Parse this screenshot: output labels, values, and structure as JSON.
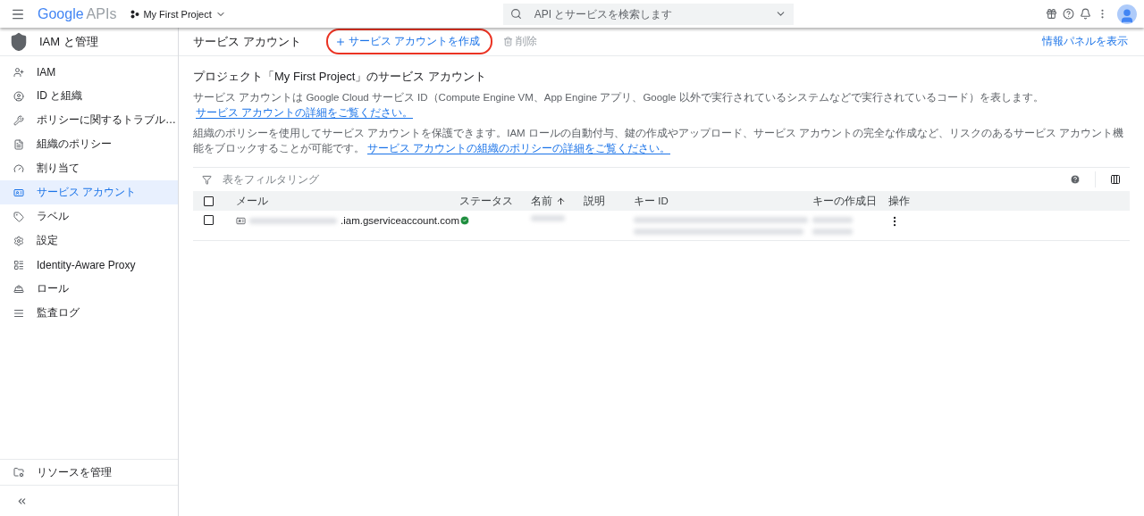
{
  "topbar": {
    "logo_brand": "Google",
    "logo_product": "APIs",
    "project": "My First Project",
    "search": {
      "placeholder": "API とサービスを検索します"
    }
  },
  "sidebar": {
    "title": "IAM と管理",
    "items": [
      {
        "label": "IAM",
        "selected": false
      },
      {
        "label": "ID と組織",
        "selected": false
      },
      {
        "label": "ポリシーに関するトラブル…",
        "selected": false
      },
      {
        "label": "組織のポリシー",
        "selected": false
      },
      {
        "label": "割り当て",
        "selected": false
      },
      {
        "label": "サービス アカウント",
        "selected": true
      },
      {
        "label": "ラベル",
        "selected": false
      },
      {
        "label": "設定",
        "selected": false
      },
      {
        "label": "Identity-Aware Proxy",
        "selected": false
      },
      {
        "label": "ロール",
        "selected": false
      },
      {
        "label": "監査ログ",
        "selected": false
      }
    ],
    "footer": {
      "label": "リソースを管理"
    }
  },
  "header": {
    "title": "サービス アカウント",
    "create": {
      "label": "サービス アカウントを作成",
      "highlighted": true
    },
    "delete": {
      "label": "削除",
      "disabled": true
    },
    "info_panel": "情報パネルを表示"
  },
  "content": {
    "heading": "プロジェクト「My First Project」のサービス アカウント",
    "paragraphs": [
      {
        "text": "サービス アカウントは Google Cloud サービス ID（Compute Engine VM、App Engine アプリ、Google 以外で実行されているシステムなどで実行されているコード）を表します。",
        "link": "サービス アカウントの詳細をご覧ください。"
      },
      {
        "text": "組織のポリシーを使用してサービス アカウントを保護できます。IAM ロールの自動付与、鍵の作成やアップロード、サービス アカウントの完全な作成など、リスクのあるサービス アカウント機能をブロックすることが可能です。",
        "link": "サービス アカウントの組織のポリシーの詳細をご覧ください。"
      }
    ]
  },
  "table": {
    "filter": {
      "placeholder": "表をフィルタリング"
    },
    "select_all": {
      "checked": false
    },
    "columns": [
      {
        "label": "メール",
        "sorted": false
      },
      {
        "label": "ステータス",
        "sorted": false
      },
      {
        "label": "名前",
        "sorted": true
      },
      {
        "label": "説明",
        "sorted": false
      },
      {
        "label": "キー ID",
        "sorted": false
      },
      {
        "label": "キーの作成日",
        "sorted": false
      },
      {
        "label": "操作",
        "sorted": false
      }
    ],
    "rows": [
      {
        "checked": false,
        "email_suffix": ".iam.gserviceaccount.com",
        "enabled": true
      }
    ]
  }
}
